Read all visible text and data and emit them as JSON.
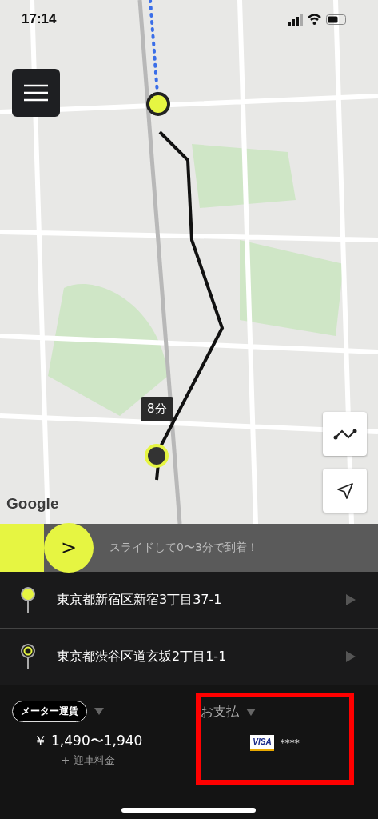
{
  "status_bar": {
    "time": "17:14"
  },
  "map": {
    "eta_badge": "8分",
    "logo": "Google"
  },
  "slider": {
    "arrow": ">",
    "hint": "スライドして0〜3分で到着！"
  },
  "route": [
    {
      "kind": "pickup",
      "address": "東京都新宿区新宿3丁目37-1"
    },
    {
      "kind": "destination",
      "address": "東京都渋谷区道玄坂2丁目1-1"
    }
  ],
  "fare": {
    "type_label": "メーター運賃",
    "amount": "￥ 1,490〜1,940",
    "note": "+ 迎車料金"
  },
  "payment": {
    "label": "お支払",
    "card_brand": "VISA",
    "card_number": "****",
    "highlighted": true
  }
}
